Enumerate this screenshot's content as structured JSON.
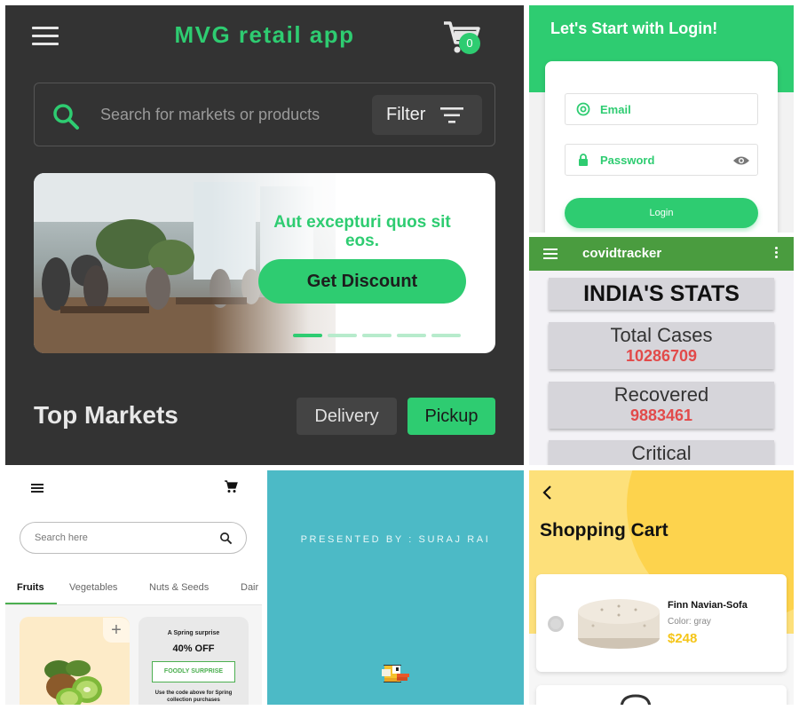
{
  "mvg": {
    "app_title": "MVG retail app",
    "cart_count": "0",
    "search_placeholder": "Search for markets or products",
    "filter_label": "Filter",
    "banner_text": "Aut excepturi quos sit eos.",
    "banner_button": "Get Discount",
    "carousel_pages": 5,
    "carousel_active": 1,
    "section_title": "Top Markets",
    "delivery_label": "Delivery",
    "pickup_label": "Pickup",
    "accent_color": "#2ecc71",
    "background_color": "#333333",
    "icons": [
      "menu-icon",
      "cart-icon",
      "search-icon",
      "filter-icon"
    ]
  },
  "login": {
    "header_title": "Let's Start with Login!",
    "email_label": "Email",
    "password_label": "Password",
    "login_button": "Login",
    "accent_color": "#2ecc71",
    "icons": [
      "at-icon",
      "lock-icon",
      "eye-icon"
    ]
  },
  "covid": {
    "app_title": "covidtracker",
    "heading": "INDIA'S STATS",
    "stats": [
      {
        "label": "Total Cases",
        "value": "10286709"
      },
      {
        "label": "Recovered",
        "value": "9883461"
      },
      {
        "label": "Critical",
        "value": ""
      }
    ],
    "bar_color": "#4a9c3f",
    "value_color": "#e24a4a",
    "icons": [
      "menu-icon",
      "more-vert-icon"
    ]
  },
  "grocery": {
    "search_placeholder": "Search here",
    "tabs": [
      "Fruits",
      "Vegetables",
      "Nuts & Seeds",
      "Dair"
    ],
    "active_tab": "Fruits",
    "add_label": "+",
    "promo": {
      "line1": "A Spring surprise",
      "discount": "40% OFF",
      "code": "FOODLY SURPRISE",
      "note": "Use the code above for Spring collection purchases"
    },
    "icons": [
      "menu-icon",
      "cart-icon",
      "search-icon",
      "kiwi-image"
    ]
  },
  "flappy": {
    "presented_by": "PRESENTED BY : SURAJ RAI",
    "background_color": "#4cbac6",
    "icons": [
      "flappy-bird-icon"
    ]
  },
  "cart": {
    "title": "Shopping Cart",
    "item": {
      "name": "Finn Navian-Sofa",
      "color": "Color: gray",
      "price": "$248"
    },
    "accent_color": "#f5c518",
    "icons": [
      "back-arrow-icon",
      "sofa-image"
    ]
  }
}
